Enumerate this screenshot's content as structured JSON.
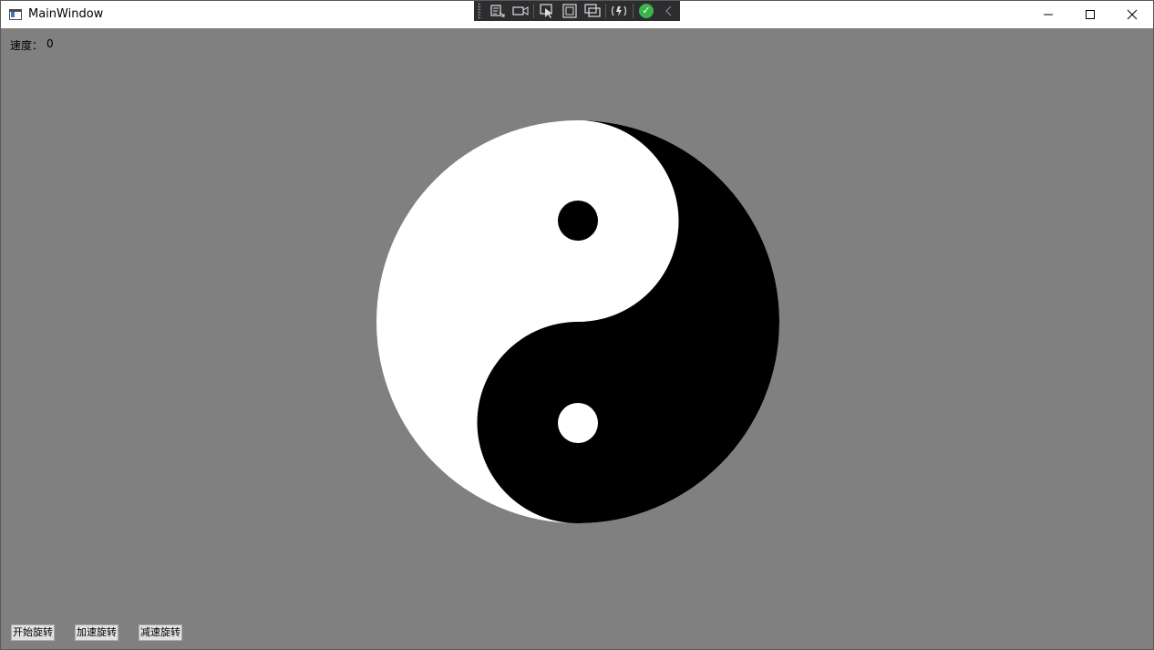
{
  "window": {
    "title": "MainWindow",
    "controls": {
      "minimize": "—",
      "maximize": "☐",
      "close": "✕"
    }
  },
  "debug_toolbar": {
    "items": [
      "select-element-icon",
      "video-camera-icon",
      "pointer-select-icon",
      "layout-box-icon",
      "track-focus-icon",
      "hot-reload-icon",
      "check-icon",
      "collapse-icon"
    ]
  },
  "status": {
    "speed_label": "速度：",
    "speed_value": "0"
  },
  "buttons": {
    "start": "开始旋转",
    "speed_up": "加速旋转",
    "slow_down": "减速旋转"
  },
  "colors": {
    "background": "#808080",
    "yin": "#000000",
    "yang": "#ffffff"
  }
}
